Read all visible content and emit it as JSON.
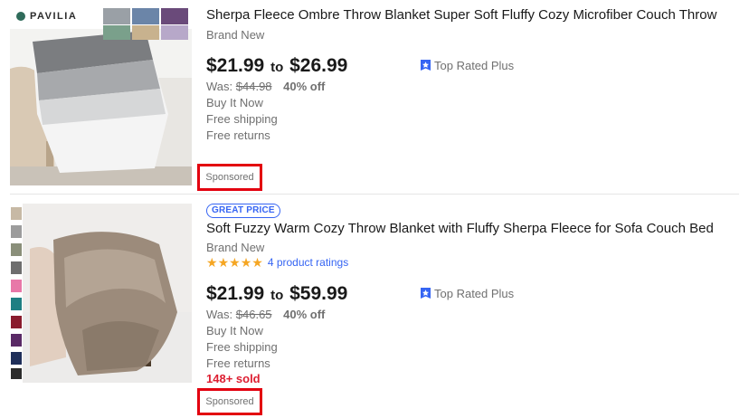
{
  "listings": [
    {
      "title": "Sherpa Fleece Ombre Throw Blanket Super Soft Fluffy Cozy Microfiber Couch Throw",
      "condition": "Brand New",
      "price_low": "$21.99",
      "price_sep": "to",
      "price_high": "$26.99",
      "was_label": "Was:",
      "was_price": "$44.98",
      "discount": "40% off",
      "buy_format": "Buy It Now",
      "shipping": "Free shipping",
      "returns": "Free returns",
      "top_rated": "Top Rated Plus",
      "sponsored": "Sponsored",
      "image_brand": "PAVILIA"
    },
    {
      "badge": "GREAT PRICE",
      "title": "Soft Fuzzy Warm Cozy Throw Blanket with Fluffy Sherpa Fleece for Sofa Couch Bed",
      "condition": "Brand New",
      "rating_stars": 5,
      "ratings_link": "4 product ratings",
      "price_low": "$21.99",
      "price_sep": "to",
      "price_high": "$59.99",
      "was_label": "Was:",
      "was_price": "$46.65",
      "discount": "40% off",
      "buy_format": "Buy It Now",
      "shipping": "Free shipping",
      "returns": "Free returns",
      "sold": "148+ sold",
      "top_rated": "Top Rated Plus",
      "sponsored": "Sponsored"
    }
  ],
  "colors": {
    "link_blue": "#3665f3",
    "sold_red": "#dd1e31",
    "highlight_red": "#e3000f",
    "star_gold": "#f5a623"
  },
  "icons": {
    "top_rated": "top-rated-badge-icon",
    "rating": "star-icon"
  }
}
